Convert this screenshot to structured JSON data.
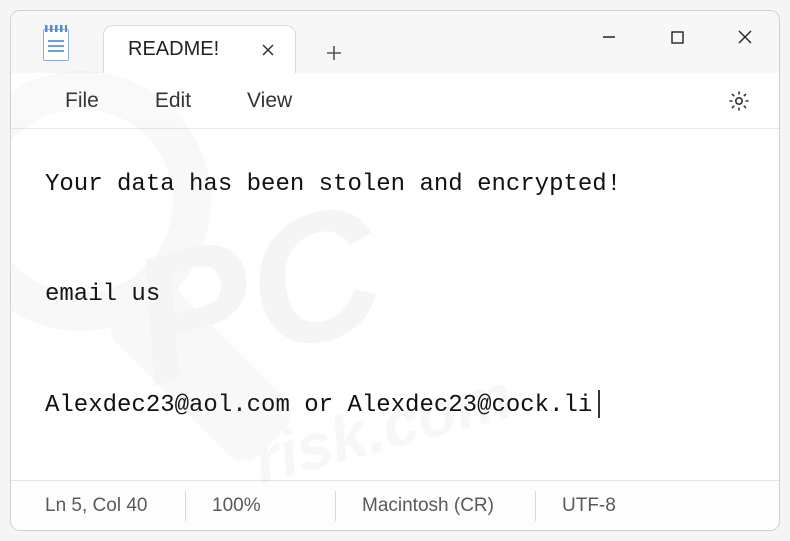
{
  "tab": {
    "title": "README!"
  },
  "menu": {
    "file": "File",
    "edit": "Edit",
    "view": "View"
  },
  "content": {
    "line1": "Your data has been stolen and encrypted!",
    "line2": "email us",
    "line3": "Alexdec23@aol.com or Alexdec23@cock.li"
  },
  "status": {
    "position": "Ln 5, Col 40",
    "zoom": "100%",
    "eol": "Macintosh (CR)",
    "encoding": "UTF-8"
  },
  "icons": {
    "close_tab": "close-icon",
    "new_tab": "plus-icon",
    "minimize": "minimize-icon",
    "maximize": "maximize-icon",
    "close_win": "close-icon",
    "settings": "gear-icon",
    "app": "notepad-icon"
  }
}
